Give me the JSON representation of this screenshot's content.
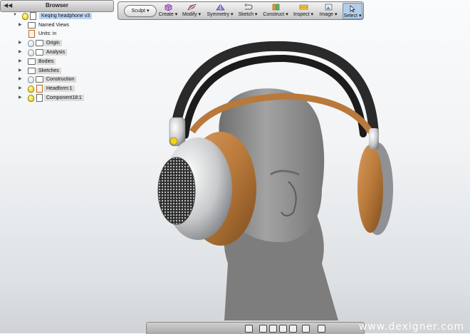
{
  "browser": {
    "title": "Browser",
    "collapse_glyph": "◀◀",
    "items": [
      {
        "label": "Keqing headphone v3",
        "icon": "document-icon",
        "visible": true
      },
      {
        "label": "Named Views",
        "icon": "folder-icon"
      },
      {
        "label": "Units: in",
        "icon": "document-icon"
      },
      {
        "label": "Origin",
        "icon": "folder-icon",
        "visible": false
      },
      {
        "label": "Analysis",
        "icon": "folder-icon",
        "visible": false
      },
      {
        "label": "Bodies",
        "icon": "folder-icon"
      },
      {
        "label": "Sketches",
        "icon": "folder-icon"
      },
      {
        "label": "Construction",
        "icon": "folder-icon",
        "visible": false
      },
      {
        "label": "Headform:1",
        "icon": "component-icon",
        "visible": true
      },
      {
        "label": "Component18:1",
        "icon": "component-icon",
        "visible": true
      }
    ]
  },
  "toolbar": {
    "workspace": "Sculpt",
    "tools": [
      {
        "label": "Create",
        "icon": "cube-icon"
      },
      {
        "label": "Modify",
        "icon": "modify-icon"
      },
      {
        "label": "Symmetry",
        "icon": "symmetry-icon"
      },
      {
        "label": "Sketch",
        "icon": "sketch-icon"
      },
      {
        "label": "Construct",
        "icon": "construct-icon"
      },
      {
        "label": "Inspect",
        "icon": "inspect-icon"
      },
      {
        "label": "Image",
        "icon": "image-icon"
      },
      {
        "label": "Select",
        "icon": "cursor-icon"
      }
    ]
  },
  "viewport": {
    "model": "Keqing headphone v3",
    "colors": {
      "headband": "#2a2a2a",
      "cushion": "#b8793a",
      "metal": "#c9cbcd",
      "head": "#8c8c8c"
    }
  },
  "watermark": "www.dexigner.com"
}
